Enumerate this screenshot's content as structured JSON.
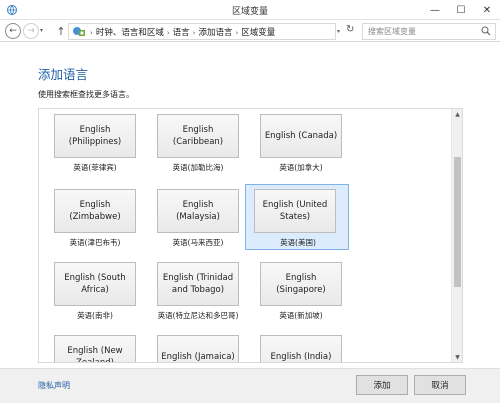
{
  "window": {
    "title": "区域变量",
    "minimize_glyph": "—",
    "maximize_glyph": "☐",
    "close_glyph": "✕"
  },
  "address": {
    "crumbs": [
      "时钟、语言和区域",
      "语言",
      "添加语言",
      "区域变量"
    ],
    "search_placeholder": "搜索区域变量"
  },
  "page": {
    "title": "添加语言",
    "instruction": "使用搜索框查找更多语言。"
  },
  "tiles": [
    {
      "label": "English (Philippines)",
      "caption": "英语(菲律宾)"
    },
    {
      "label": "English (Caribbean)",
      "caption": "英语(加勒比海)"
    },
    {
      "label": "English (Canada)",
      "caption": "英语(加拿大)"
    },
    {
      "label": "English (Zimbabwe)",
      "caption": "英语(津巴布韦)"
    },
    {
      "label": "English (Malaysia)",
      "caption": "英语(马来西亚)"
    },
    {
      "label": "English (United States)",
      "caption": "英语(美国)"
    },
    {
      "label": "English (South Africa)",
      "caption": "英语(南非)"
    },
    {
      "label": "English (Trinidad and Tobago)",
      "caption": "英语(特立尼达和多巴哥)"
    },
    {
      "label": "English (Singapore)",
      "caption": "英语(新加坡)"
    },
    {
      "label": "English (New Zealand)",
      "caption": ""
    },
    {
      "label": "English (Jamaica)",
      "caption": ""
    },
    {
      "label": "English (India)",
      "caption": ""
    }
  ],
  "selected_tile": "English (United States)",
  "footer": {
    "privacy": "隐私声明",
    "add": "添加",
    "cancel": "取消"
  },
  "colors": {
    "link": "#1f5fa8",
    "selection_bg": "#dcecfc",
    "selection_border": "#7eb4ea"
  }
}
